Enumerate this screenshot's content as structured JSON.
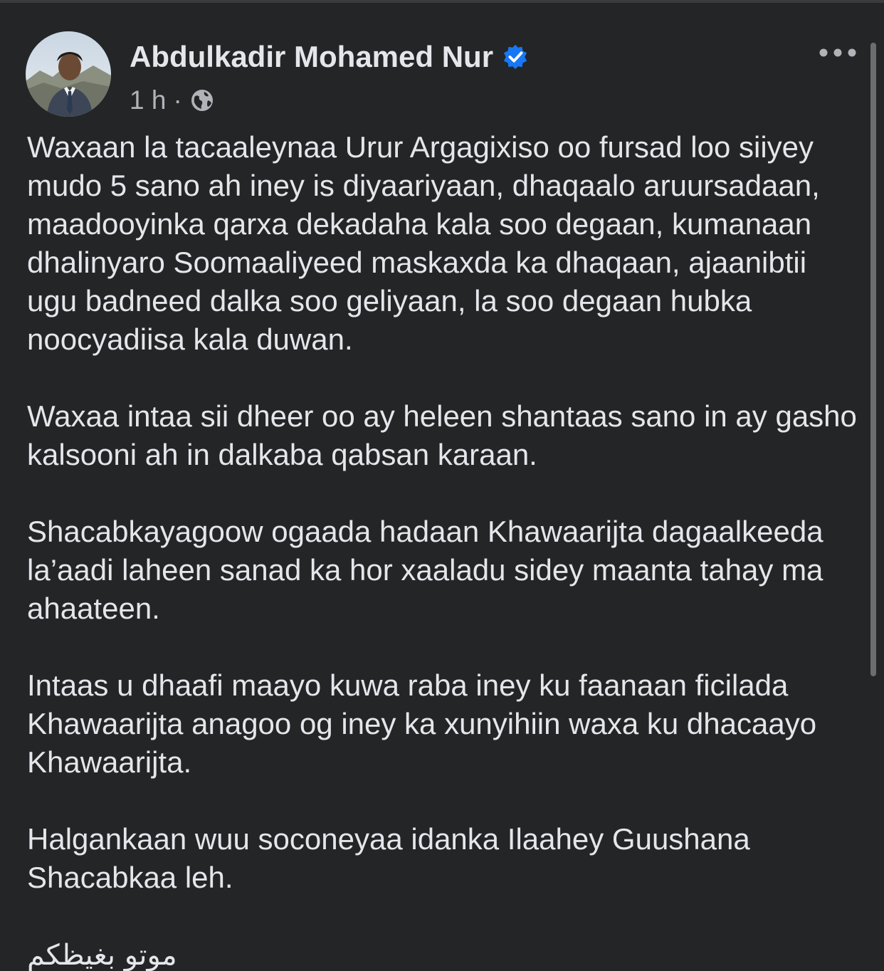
{
  "post": {
    "author": "Abdulkadir Mohamed Nur",
    "timestamp": "1 h",
    "separator": "·",
    "audience_icon": "globe-icon",
    "verified_icon": "verified-badge-icon",
    "more_icon": "more-options-icon",
    "paragraphs": [
      "Waxaan la tacaaleynaa Urur Argagixiso oo fursad loo siiyey mudo 5 sano ah iney is diyaariyaan, dhaqaalo aruursadaan, maadooyinka qarxa dekadaha kala soo degaan, kumanaan dhalinyaro Soomaaliyeed maskaxda ka dhaqaan, ajaanibtii ugu badneed dalka soo geliyaan, la soo degaan hubka noocyadiisa kala duwan.",
      "Waxaa intaa sii dheer oo ay heleen shantaas sano in ay gasho kalsooni ah in dalkaba qabsan karaan.",
      "Shacabkayagoow ogaada hadaan Khawaarijta dagaalkeeda la’aadi laheen sanad ka hor xaaladu sidey maanta tahay ma ahaateen.",
      "Intaas u dhaafi maayo kuwa raba iney ku faanaan ficilada Khawaarijta anagoo og iney ka xunyihiin waxa ku dhacaayo Khawaarijta.",
      "Halgankaan wuu soconeyaa idanka Ilaahey Guushana Shacabkaa leh."
    ],
    "closing_arabic": "موتو بغيظكم"
  },
  "colors": {
    "background": "#242526",
    "text_primary": "#e4e6eb",
    "text_secondary": "#b0b3b8",
    "verified_blue": "#1877f2"
  }
}
